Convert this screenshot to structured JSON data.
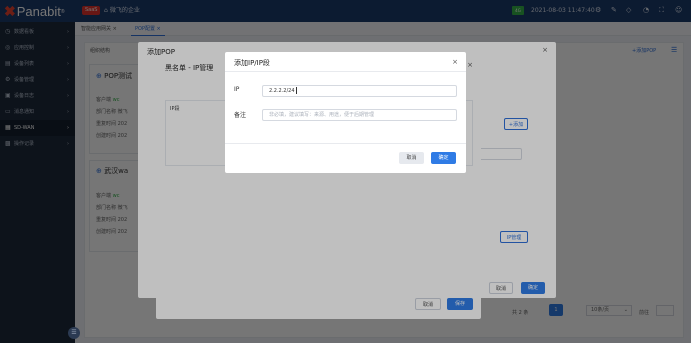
{
  "header": {
    "logo_text": "Panabit",
    "logo_reg": "®",
    "saas_badge": "SaaS",
    "org_name": "微飞的企业",
    "status_label": "4G",
    "datetime": "2021-08-03 11:47:40"
  },
  "sidebar": {
    "items": [
      {
        "label": "数据看板",
        "icon": "dashboard-icon"
      },
      {
        "label": "应用控制",
        "icon": "app-control-icon"
      },
      {
        "label": "设备列表",
        "icon": "device-list-icon"
      },
      {
        "label": "设备管理",
        "icon": "device-manage-icon"
      },
      {
        "label": "设备日志",
        "icon": "log-icon"
      },
      {
        "label": "消息通知",
        "icon": "message-icon"
      },
      {
        "label": "SD-WAN",
        "icon": "sdwan-icon"
      },
      {
        "label": "操作记录",
        "icon": "history-icon"
      }
    ]
  },
  "tabs": [
    {
      "label": "智能应用网关 ×"
    },
    {
      "label": "POP配置 ×"
    }
  ],
  "background": {
    "breadcrumb": "组织结构",
    "add_pop": "+添加POP",
    "pop1_title": "POP测试",
    "pop2_title": "武汉wa",
    "rows": [
      {
        "k": "客户端",
        "v": "wc"
      },
      {
        "k": "部门名称",
        "v": "微飞"
      },
      {
        "k": "重复时间",
        "v": "202"
      },
      {
        "k": "创建时间",
        "v": "202"
      }
    ],
    "add_btn": "+添加",
    "ip_manage_btn": "IP管理",
    "total": "共 2 条",
    "page": "1",
    "page_size": "10条/页",
    "goto": "前往"
  },
  "modal_add_pop": {
    "title": "添加POP",
    "cancel": "取消",
    "confirm": "确定"
  },
  "modal_blacklist": {
    "title": "黑名单 - IP管理",
    "column_ip": "IP段",
    "cancel": "取消",
    "save": "保存"
  },
  "modal_add_ip": {
    "title": "添加IP/IP段",
    "ip_label": "IP",
    "ip_value": "2.2.2.2/24",
    "remark_label": "备注",
    "remark_placeholder": "非必填，建议填写：来源、用途，便于后期管理",
    "cancel": "取消",
    "confirm": "确定"
  }
}
